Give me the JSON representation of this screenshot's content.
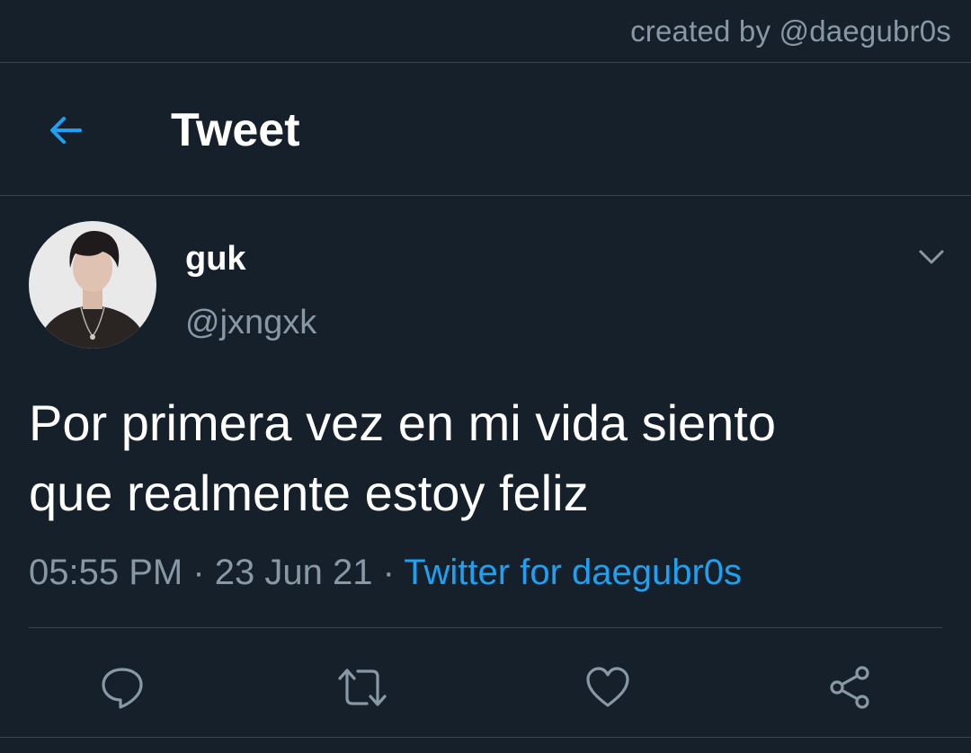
{
  "credit": "created by @daegubr0s",
  "header": {
    "title": "Tweet",
    "back_icon": "arrow-left-icon"
  },
  "tweet": {
    "display_name": "guk",
    "handle": "@jxngxk",
    "text_line1": "Por primera vez en mi vida siento",
    "text_line2": "que realmente estoy feliz",
    "time": "05:55 PM",
    "date": "23 Jun 21",
    "separator": " · ",
    "source": "Twitter for daegubr0s"
  },
  "actions": [
    "reply-icon",
    "retweet-icon",
    "like-icon",
    "share-icon"
  ],
  "colors": {
    "background": "#15202b",
    "accent": "#1da1f2",
    "secondary_text": "#8899a6",
    "divider": "#38444d"
  }
}
